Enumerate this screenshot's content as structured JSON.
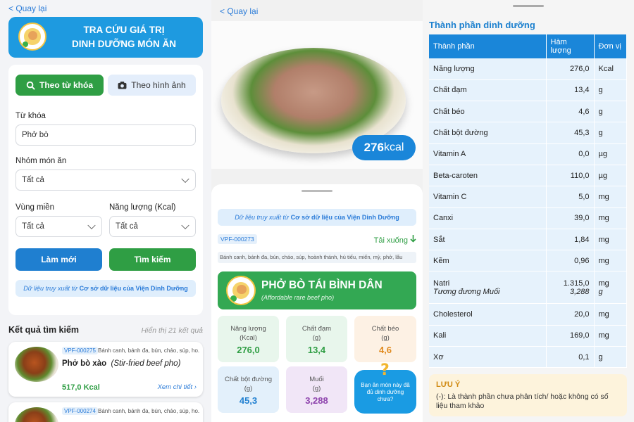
{
  "search": {
    "back": "< Quay lại",
    "banner": {
      "line1": "TRA CỨU GIÁ TRỊ",
      "line2": "DINH DƯỠNG MÓN ĂN"
    },
    "tab_keyword": "Theo từ khóa",
    "tab_image": "Theo hình ảnh",
    "keyword_label": "Từ khóa",
    "keyword_value": "Phở bò",
    "group_label": "Nhóm món ăn",
    "group_value": "Tất cả",
    "region_label": "Vùng miền",
    "region_value": "Tất cả",
    "energy_label": "Năng lượng (Kcal)",
    "energy_value": "Tất cả",
    "reset": "Làm mới",
    "search": "Tìm kiếm",
    "source_prefix": "Dữ liệu truy xuất từ",
    "source_name": "Cơ sở dữ liệu của Viện Dinh Dưỡng",
    "results_title": "Kết quả tìm kiếm",
    "results_count": "Hiển thị 21 kết quả",
    "results": [
      {
        "code": "VPF-000275",
        "tags": "Bánh canh, bánh đa, bún, cháo, súp, ho...",
        "name": "Phở bò xào",
        "en": "(Stir-fried beef pho)",
        "kcal": "517,0 Kcal",
        "detail": "Xem chi tiết ›"
      },
      {
        "code": "VPF-000274",
        "tags": "Bánh canh, bánh đa, bún, cháo, súp, ho..."
      }
    ]
  },
  "dish": {
    "back": "< Quay lại",
    "kcal_num": "276",
    "kcal_unit": "kcal",
    "source_prefix": "Dữ liệu truy xuất từ",
    "source_name": "Cơ sở dữ liệu của Viện Dinh Dưỡng",
    "code": "VPF-000273",
    "download": "Tải xuống",
    "tags": "Bánh canh, bánh đa, bún, cháo, súp, hoành thánh, hủ tiếu, miến, mỳ, phở, lẩu",
    "name": "PHỞ BÒ TÁI BÌNH DÂN",
    "en": "(Affordable rare beef pho)",
    "boxes": [
      {
        "label1": "Năng lượng",
        "label2": "(Kcal)",
        "value": "276,0",
        "bg": "#e8f6ec",
        "color": "#2f9e44"
      },
      {
        "label1": "Chất đạm",
        "label2": "(g)",
        "value": "13,4",
        "bg": "#e8f6ec",
        "color": "#2f9e44"
      },
      {
        "label1": "Chất béo",
        "label2": "(g)",
        "value": "4,6",
        "bg": "#fdf1e4",
        "color": "#e08a1e"
      },
      {
        "label1": "Chất bột đường",
        "label2": "(g)",
        "value": "45,3",
        "bg": "#e3f0fb",
        "color": "#1f7fd0"
      },
      {
        "label1": "Muối",
        "label2": "(g)",
        "value": "3,288",
        "bg": "#f1e6f7",
        "color": "#8e44ad"
      }
    ],
    "question": "Bạn ăn món này đã đủ dinh dưỡng chưa?"
  },
  "nutrition": {
    "title": "Thành phần dinh dưỡng",
    "headers": [
      "Thành phần",
      "Hàm lượng",
      "Đơn vị"
    ],
    "rows": [
      {
        "name": "Năng lượng",
        "value": "276,0",
        "unit": "Kcal"
      },
      {
        "name": "Chất đạm",
        "value": "13,4",
        "unit": "g"
      },
      {
        "name": "Chất béo",
        "value": "4,6",
        "unit": "g"
      },
      {
        "name": "Chất bột đường",
        "value": "45,3",
        "unit": "g"
      },
      {
        "name": "Vitamin A",
        "value": "0,0",
        "unit": "µg"
      },
      {
        "name": "Beta-caroten",
        "value": "110,0",
        "unit": "µg"
      },
      {
        "name": "Vitamin C",
        "value": "5,0",
        "unit": "mg"
      },
      {
        "name": "Canxi",
        "value": "39,0",
        "unit": "mg"
      },
      {
        "name": "Sắt",
        "value": "1,84",
        "unit": "mg"
      },
      {
        "name": "Kẽm",
        "value": "0,96",
        "unit": "mg"
      },
      {
        "name": "Natri",
        "name2": "Tương đương Muối",
        "value": "1.315,0",
        "value2": "3,288",
        "unit": "mg",
        "unit2": "g"
      },
      {
        "name": "Cholesterol",
        "value": "20,0",
        "unit": "mg"
      },
      {
        "name": "Kali",
        "value": "169,0",
        "unit": "mg"
      },
      {
        "name": "Xơ",
        "value": "0,1",
        "unit": "g"
      }
    ],
    "note_title": "LƯU Ý",
    "note_text": "(-): Là thành phần chưa phân tích/ hoặc không có số liệu tham khảo"
  }
}
